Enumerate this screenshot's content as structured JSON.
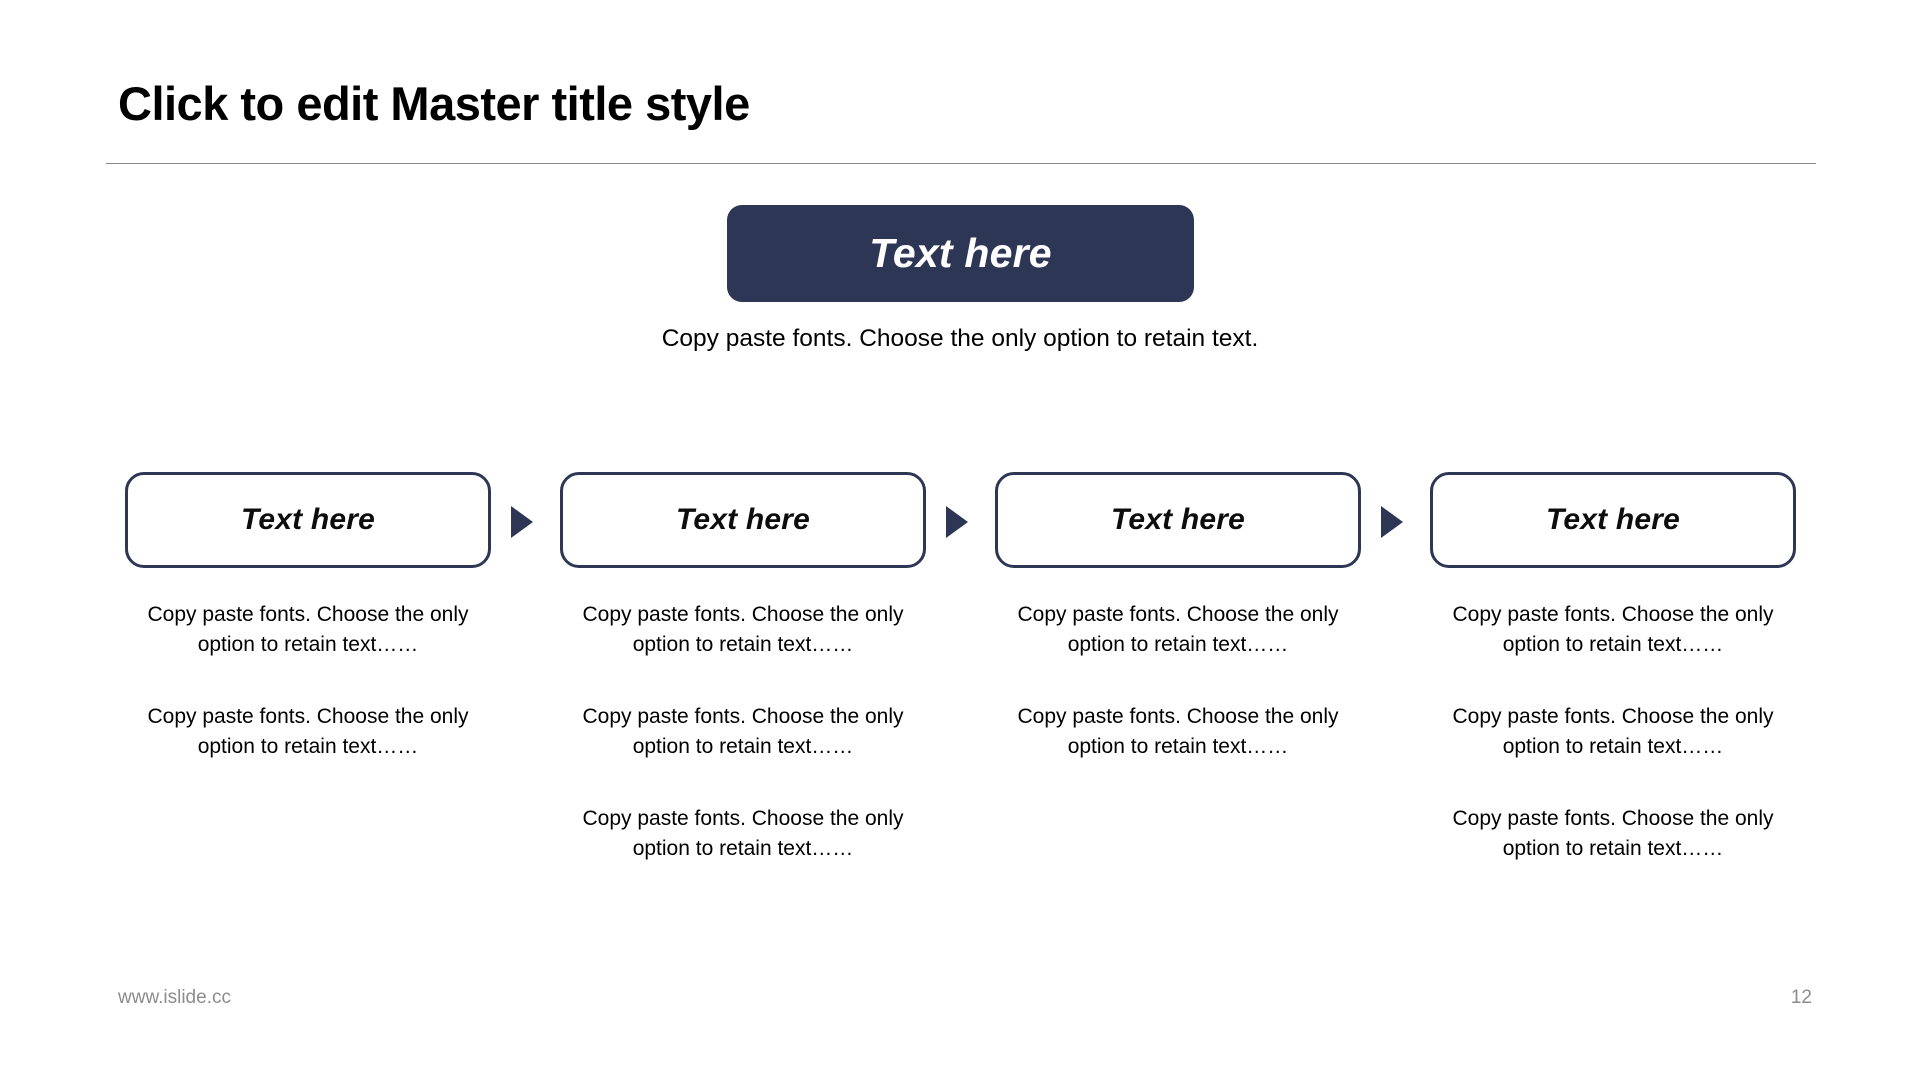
{
  "slide": {
    "title": "Click to edit Master title style",
    "background_color": "#ffffff",
    "accent_color": "#2d3654",
    "divider_color": "#8a8a8a"
  },
  "headline": {
    "badge_label": "Text here",
    "badge_fill": "#2d3654",
    "badge_text_color": "#ffffff",
    "subtitle": "Copy paste fonts. Choose the only option to retain text."
  },
  "process": {
    "arrow_icon": "triangle-right-icon",
    "steps": [
      {
        "label": "Text here"
      },
      {
        "label": "Text here"
      },
      {
        "label": "Text here"
      },
      {
        "label": "Text here"
      }
    ],
    "arrows": [
      {
        "icon": "triangle-right-icon"
      },
      {
        "icon": "triangle-right-icon"
      },
      {
        "icon": "triangle-right-icon"
      }
    ]
  },
  "columns": [
    {
      "paragraphs": [
        "Copy paste fonts. Choose the only option to retain text……",
        "Copy paste fonts. Choose the only option to retain text……"
      ]
    },
    {
      "paragraphs": [
        "Copy paste fonts. Choose the only option to retain text……",
        "Copy paste fonts. Choose the only option to retain text……",
        "Copy paste fonts. Choose the only option to retain text……"
      ]
    },
    {
      "paragraphs": [
        "Copy paste fonts. Choose the only option to retain text……",
        "Copy paste fonts. Choose the only option to retain text……"
      ]
    },
    {
      "paragraphs": [
        "Copy paste fonts. Choose the only option to retain text……",
        "Copy paste fonts. Choose the only option to retain text……",
        "Copy paste fonts. Choose the only option to retain text……"
      ]
    }
  ],
  "footer": {
    "url": "www.islide.cc",
    "page_number": "12"
  }
}
